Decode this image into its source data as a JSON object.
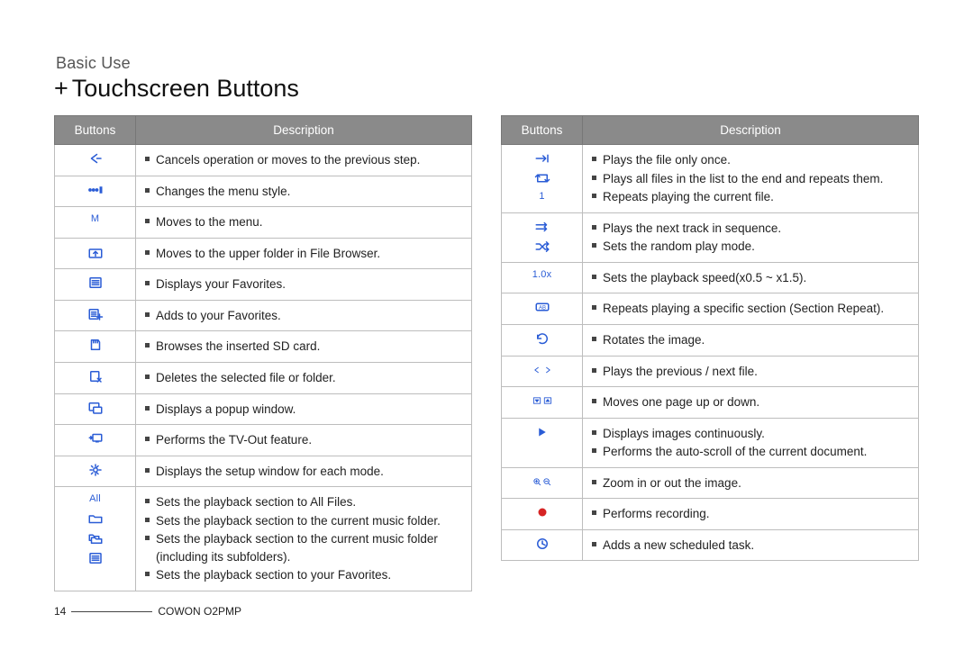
{
  "header": {
    "section": "Basic Use",
    "title": "Touchscreen Buttons"
  },
  "footer": {
    "page_number": "14",
    "product": "COWON O2PMP"
  },
  "table_headers": {
    "buttons": "Buttons",
    "description": "Description"
  },
  "left_rows": [
    {
      "icons": [
        {
          "name": "back-arrow-icon",
          "kind": "svg",
          "svg": "back"
        }
      ],
      "desc": [
        "Cancels operation or moves to the previous step."
      ]
    },
    {
      "icons": [
        {
          "name": "menu-style-icon",
          "kind": "svg",
          "svg": "dots-bars"
        }
      ],
      "desc": [
        "Changes the menu style."
      ]
    },
    {
      "icons": [
        {
          "name": "menu-m-icon",
          "kind": "text",
          "text": "M"
        }
      ],
      "desc": [
        "Moves to the menu."
      ]
    },
    {
      "icons": [
        {
          "name": "folder-up-icon",
          "kind": "svg",
          "svg": "folder-up"
        }
      ],
      "desc": [
        "Moves to the upper folder in File Browser."
      ]
    },
    {
      "icons": [
        {
          "name": "favorites-list-icon",
          "kind": "svg",
          "svg": "list"
        }
      ],
      "desc": [
        "Displays your Favorites."
      ]
    },
    {
      "icons": [
        {
          "name": "add-favorite-icon",
          "kind": "svg",
          "svg": "list-plus"
        }
      ],
      "desc": [
        "Adds to your Favorites."
      ]
    },
    {
      "icons": [
        {
          "name": "sd-card-icon",
          "kind": "svg",
          "svg": "sd"
        }
      ],
      "desc": [
        "Browses the inserted SD card."
      ]
    },
    {
      "icons": [
        {
          "name": "delete-file-icon",
          "kind": "svg",
          "svg": "file-x"
        }
      ],
      "desc": [
        "Deletes the selected file or folder."
      ]
    },
    {
      "icons": [
        {
          "name": "popup-window-icon",
          "kind": "svg",
          "svg": "popup"
        }
      ],
      "desc": [
        "Displays a popup window."
      ]
    },
    {
      "icons": [
        {
          "name": "tv-out-icon",
          "kind": "svg",
          "svg": "tvout"
        }
      ],
      "desc": [
        "Performs the TV-Out feature."
      ]
    },
    {
      "icons": [
        {
          "name": "setup-gear-icon",
          "kind": "svg",
          "svg": "gear"
        }
      ],
      "desc": [
        "Displays the setup window for each mode."
      ]
    },
    {
      "icons": [
        {
          "name": "all-files-icon",
          "kind": "text",
          "text": "All"
        },
        {
          "name": "music-folder-icon",
          "kind": "svg",
          "svg": "folder"
        },
        {
          "name": "music-folder-sub-icon",
          "kind": "svg",
          "svg": "folders"
        },
        {
          "name": "favorites-section-icon",
          "kind": "svg",
          "svg": "list"
        }
      ],
      "desc": [
        "Sets the playback section to All Files.",
        "Sets the playback section to the current music folder.",
        "Sets the playback section to the current music folder (including its subfolders).",
        "Sets the playback section to your Favorites."
      ]
    }
  ],
  "right_rows": [
    {
      "icons": [
        {
          "name": "play-once-icon",
          "kind": "svg",
          "svg": "arrow-right-stop"
        },
        {
          "name": "repeat-all-icon",
          "kind": "svg",
          "svg": "loop"
        },
        {
          "name": "repeat-one-icon",
          "kind": "text",
          "text": "1"
        }
      ],
      "desc": [
        "Plays the file only once.",
        "Plays all files in the list to the end and repeats them.",
        "Repeats playing the current file."
      ]
    },
    {
      "icons": [
        {
          "name": "next-track-icon",
          "kind": "svg",
          "svg": "sequential"
        },
        {
          "name": "shuffle-icon",
          "kind": "svg",
          "svg": "shuffle"
        }
      ],
      "desc": [
        "Plays the next track in sequence.",
        "Sets the random play mode."
      ]
    },
    {
      "icons": [
        {
          "name": "playback-speed-icon",
          "kind": "text",
          "text": "1.0x"
        }
      ],
      "desc": [
        "Sets the playback speed(x0.5 ~ x1.5)."
      ]
    },
    {
      "icons": [
        {
          "name": "section-repeat-icon",
          "kind": "svg",
          "svg": "ab"
        }
      ],
      "desc": [
        "Repeats playing a specific section (Section Repeat)."
      ]
    },
    {
      "icons": [
        {
          "name": "rotate-image-icon",
          "kind": "svg",
          "svg": "rotate"
        }
      ],
      "desc": [
        "Rotates the image."
      ]
    },
    {
      "icons": [
        {
          "name": "prev-next-file-icon",
          "kind": "svg",
          "svg": "prev-next"
        }
      ],
      "desc": [
        "Plays the previous / next file."
      ]
    },
    {
      "icons": [
        {
          "name": "page-up-down-icon",
          "kind": "svg",
          "svg": "page-updown"
        }
      ],
      "desc": [
        "Moves one page up or down."
      ]
    },
    {
      "icons": [
        {
          "name": "slideshow-icon",
          "kind": "svg",
          "svg": "play-triangle"
        }
      ],
      "desc": [
        "Displays images continuously.",
        "Performs the auto-scroll of the current document."
      ]
    },
    {
      "icons": [
        {
          "name": "zoom-in-out-icon",
          "kind": "svg",
          "svg": "zoom"
        }
      ],
      "desc": [
        "Zoom in or out the image."
      ]
    },
    {
      "icons": [
        {
          "name": "record-icon",
          "kind": "svg",
          "svg": "record"
        }
      ],
      "desc": [
        "Performs recording."
      ]
    },
    {
      "icons": [
        {
          "name": "schedule-task-icon",
          "kind": "svg",
          "svg": "clock"
        }
      ],
      "desc": [
        "Adds a new scheduled task."
      ]
    }
  ]
}
